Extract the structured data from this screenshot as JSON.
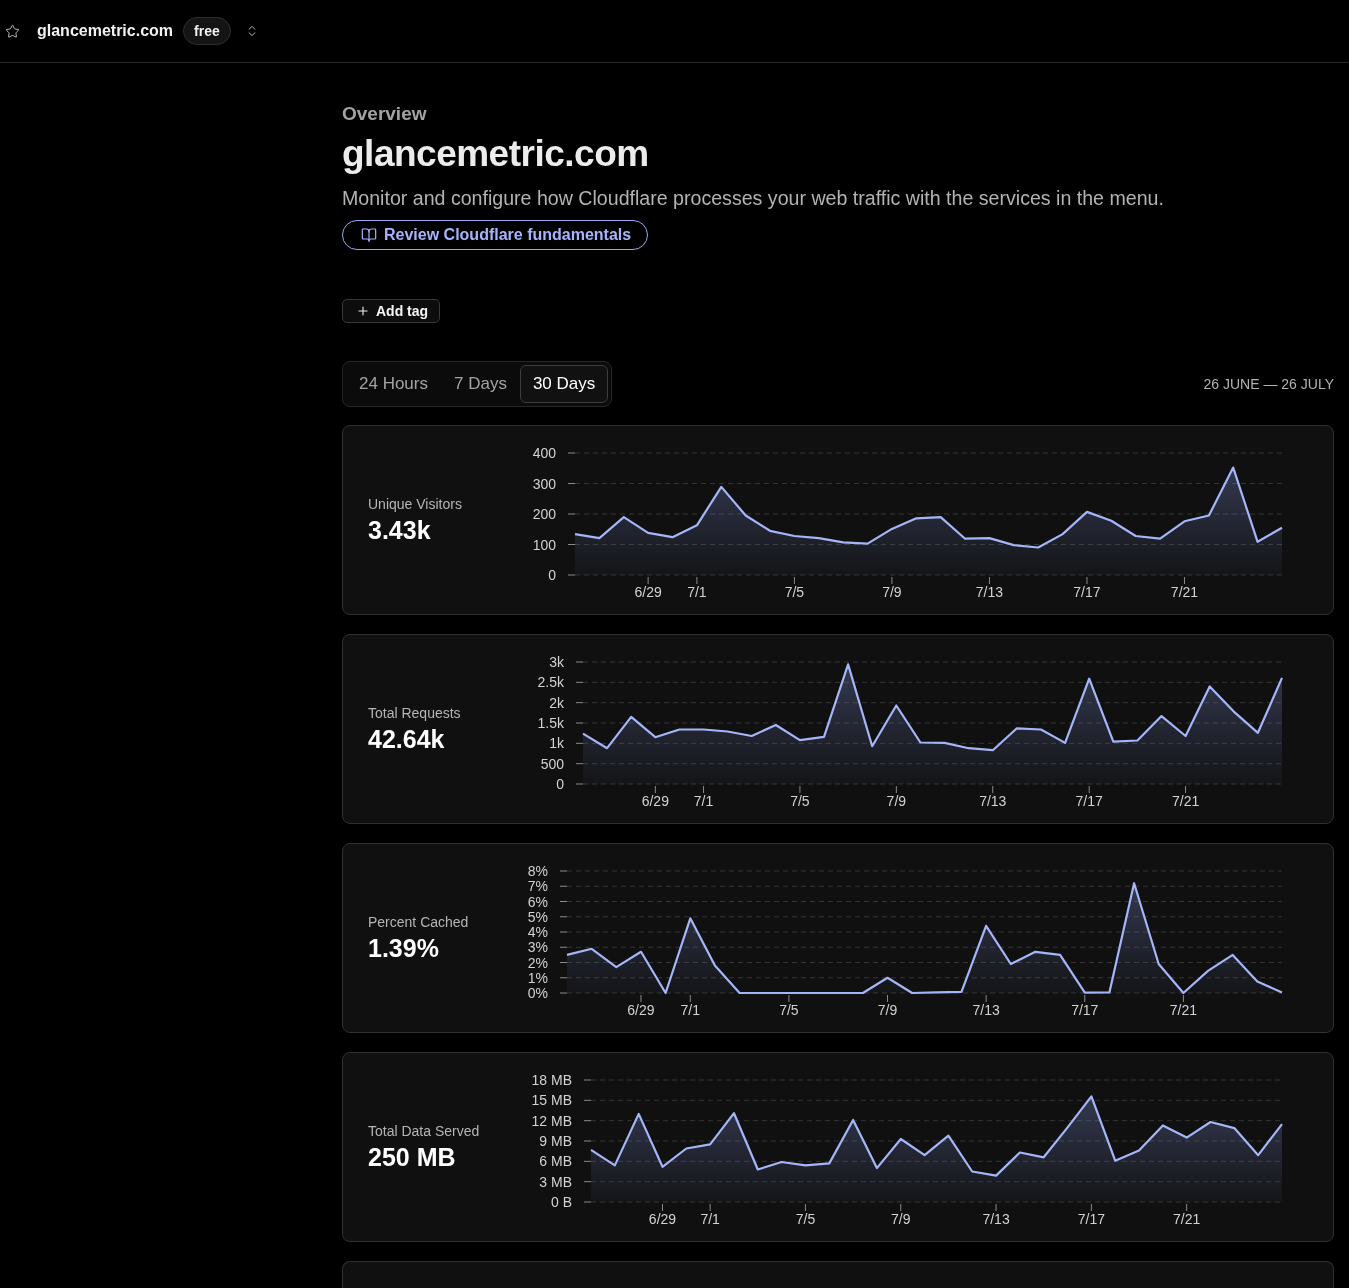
{
  "top_bar": {
    "site": "glancemetric.com",
    "plan": "free"
  },
  "header": {
    "section": "Overview",
    "title": "glancemetric.com",
    "description": "Monitor and configure how Cloudflare processes your web traffic with the services in the menu.",
    "link": "Review Cloudflare fundamentals"
  },
  "add_tag": "Add tag",
  "time_range": {
    "tabs": [
      {
        "label": "24 Hours",
        "selected": false
      },
      {
        "label": "7 Days",
        "selected": false
      },
      {
        "label": "30 Days",
        "selected": true
      }
    ],
    "date_range": "26 JUNE — 26 JULY"
  },
  "metrics": [
    {
      "label": "Unique Visitors",
      "value": "3.43k",
      "chart_data": {
        "type": "area",
        "grid": true,
        "categories": [
          null,
          null,
          null,
          "6/29",
          null,
          "7/1",
          null,
          null,
          null,
          "7/5",
          null,
          null,
          null,
          "7/9",
          null,
          null,
          null,
          "7/13",
          null,
          null,
          null,
          "7/17",
          null,
          null,
          null,
          "7/21",
          null,
          null,
          null,
          null
        ],
        "values": [
          134,
          121,
          190,
          138,
          124,
          163,
          289,
          195,
          145,
          128,
          121,
          107,
          103,
          151,
          186,
          190,
          119,
          121,
          98,
          90,
          134,
          207,
          178,
          128,
          119,
          176,
          195,
          352,
          109,
          155
        ],
        "ylim": [
          0,
          400
        ],
        "yticks": [
          0,
          100,
          200,
          300,
          400
        ]
      }
    },
    {
      "label": "Total Requests",
      "value": "42.64k",
      "chart_data": {
        "type": "area",
        "grid": true,
        "categories": [
          null,
          null,
          null,
          "6/29",
          null,
          "7/1",
          null,
          null,
          null,
          "7/5",
          null,
          null,
          null,
          "7/9",
          null,
          null,
          null,
          "7/13",
          null,
          null,
          null,
          "7/17",
          null,
          null,
          null,
          "7/21",
          null,
          null,
          null,
          null
        ],
        "values": [
          1240,
          880,
          1650,
          1150,
          1340,
          1340,
          1290,
          1180,
          1450,
          1080,
          1160,
          2940,
          930,
          1930,
          1020,
          1010,
          880,
          830,
          1370,
          1340,
          1010,
          2590,
          1040,
          1070,
          1670,
          1180,
          2400,
          1780,
          1260,
          2610
        ],
        "ylim": [
          0,
          3000
        ],
        "yticks": [
          0,
          {
            "value": 500,
            "label": "500"
          },
          {
            "value": 1000,
            "label": "1k"
          },
          {
            "value": 1500,
            "label": "1.5k"
          },
          {
            "value": 2000,
            "label": "2k"
          },
          {
            "value": 2500,
            "label": "2.5k"
          },
          {
            "value": 3000,
            "label": "3k"
          }
        ]
      }
    },
    {
      "label": "Percent Cached",
      "value": "1.39%",
      "chart_data": {
        "type": "area",
        "grid": true,
        "categories": [
          null,
          null,
          null,
          "6/29",
          null,
          "7/1",
          null,
          null,
          null,
          "7/5",
          null,
          null,
          null,
          "7/9",
          null,
          null,
          null,
          "7/13",
          null,
          null,
          null,
          "7/17",
          null,
          null,
          null,
          "7/21",
          null,
          null,
          null,
          null
        ],
        "values": [
          2.5,
          2.9,
          1.7,
          2.7,
          0,
          4.9,
          1.8,
          0,
          0,
          0,
          0,
          0,
          0,
          1.0,
          0,
          0.04,
          0.08,
          4.4,
          1.9,
          2.7,
          2.5,
          0.02,
          0.04,
          7.2,
          1.9,
          0,
          1.45,
          2.5,
          0.75,
          0.04
        ],
        "ylim": [
          0,
          8
        ],
        "yticks": [
          {
            "value": 0,
            "label": "0%"
          },
          {
            "value": 1,
            "label": "1%"
          },
          {
            "value": 2,
            "label": "2%"
          },
          {
            "value": 3,
            "label": "3%"
          },
          {
            "value": 4,
            "label": "4%"
          },
          {
            "value": 5,
            "label": "5%"
          },
          {
            "value": 6,
            "label": "6%"
          },
          {
            "value": 7,
            "label": "7%"
          },
          {
            "value": 8,
            "label": "8%"
          }
        ]
      }
    },
    {
      "label": "Total Data Served",
      "value": "250 MB",
      "chart_data": {
        "type": "area",
        "grid": true,
        "categories": [
          null,
          null,
          null,
          "6/29",
          null,
          "7/1",
          null,
          null,
          null,
          "7/5",
          null,
          null,
          null,
          "7/9",
          null,
          null,
          null,
          "7/13",
          null,
          null,
          null,
          "7/17",
          null,
          null,
          null,
          "7/21",
          null,
          null,
          null,
          null
        ],
        "values": [
          7.7,
          5.4,
          13.0,
          5.2,
          7.9,
          8.5,
          13.1,
          4.8,
          5.9,
          5.4,
          5.7,
          12.1,
          5.0,
          9.3,
          6.9,
          9.8,
          4.5,
          3.9,
          7.3,
          6.6,
          11.0,
          15.6,
          6.1,
          7.6,
          11.3,
          9.5,
          11.8,
          10.9,
          6.9,
          11.5
        ],
        "ylim": [
          0,
          18
        ],
        "yticks": [
          {
            "value": 0,
            "label": "0 B"
          },
          {
            "value": 3,
            "label": "3 MB"
          },
          {
            "value": 6,
            "label": "6 MB"
          },
          {
            "value": 9,
            "label": "9 MB"
          },
          {
            "value": 12,
            "label": "12 MB"
          },
          {
            "value": 15,
            "label": "15 MB"
          },
          {
            "value": 18,
            "label": "18 MB"
          }
        ]
      }
    }
  ]
}
